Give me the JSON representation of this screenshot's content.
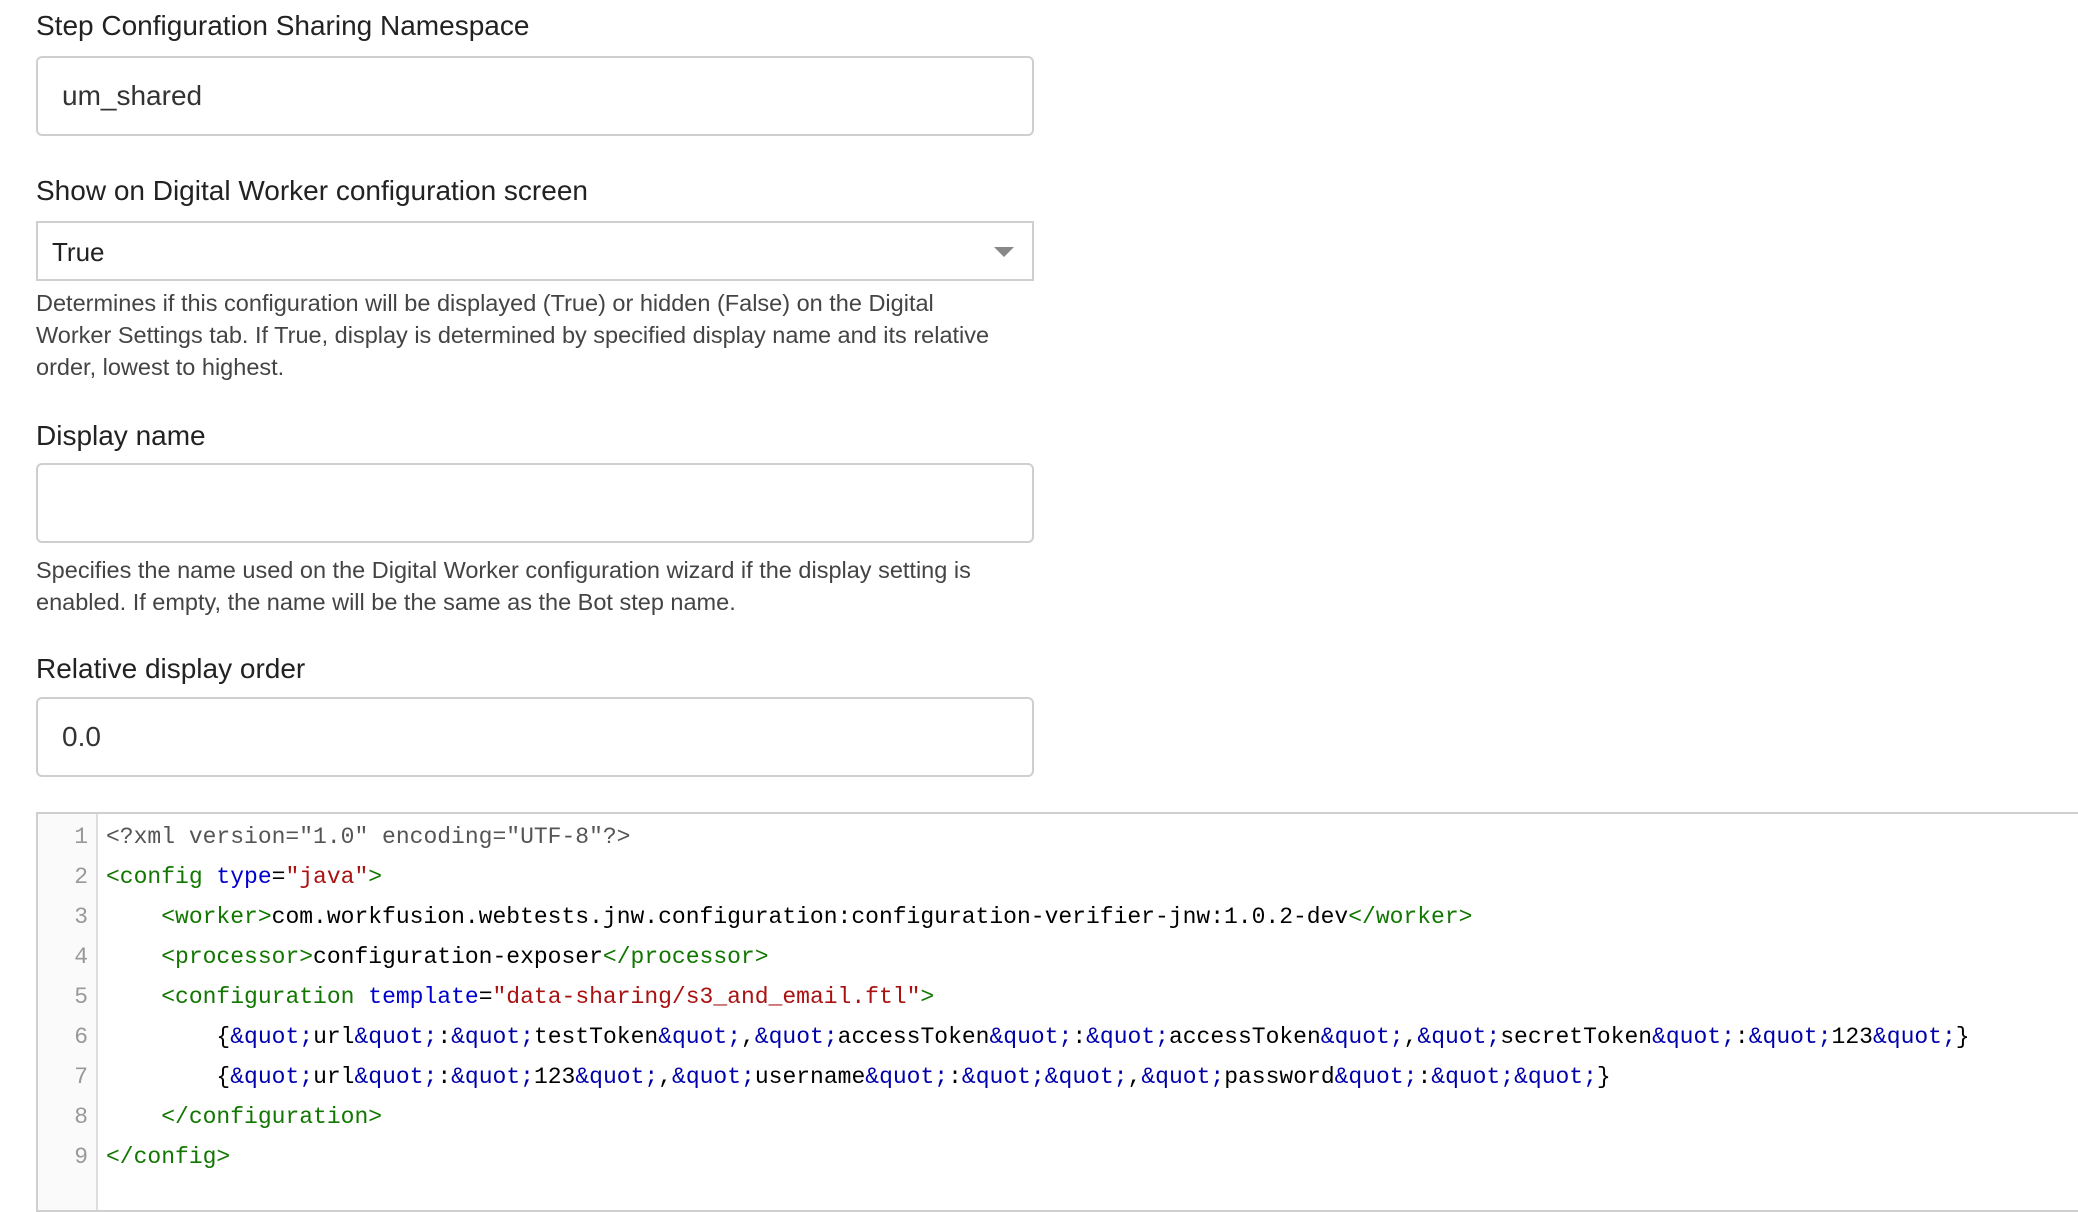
{
  "fields": {
    "namespace": {
      "label": "Step Configuration Sharing Namespace",
      "value": "um_shared"
    },
    "show_on_screen": {
      "label": "Show on Digital Worker configuration screen",
      "selected": "True",
      "help_line1": "Determines if this configuration will be displayed (True) or hidden (False) on the Digital",
      "help_line2": "Worker Settings tab. If True, display is determined by specified display name and its relative",
      "help_line3": "order, lowest to highest."
    },
    "display_name": {
      "label": "Display name",
      "value": "",
      "help_line1": "Specifies the name used on the Digital Worker configuration wizard if the display setting is",
      "help_line2": "enabled. If empty, the name will be the same as the Bot step name."
    },
    "display_order": {
      "label": "Relative display order",
      "value": "0.0"
    }
  },
  "code_editor": {
    "lines": [
      {
        "no": "1",
        "tokens": [
          {
            "c": "meta",
            "t": "<?xml version=\"1.0\" encoding=\"UTF-8\"?>"
          }
        ]
      },
      {
        "no": "2",
        "tokens": [
          {
            "c": "tag",
            "t": "<config "
          },
          {
            "c": "attr",
            "t": "type"
          },
          {
            "c": "txt",
            "t": "="
          },
          {
            "c": "str",
            "t": "\"java\""
          },
          {
            "c": "tag",
            "t": ">"
          }
        ]
      },
      {
        "no": "3",
        "tokens": [
          {
            "c": "txt",
            "t": "    "
          },
          {
            "c": "tag",
            "t": "<worker>"
          },
          {
            "c": "txt",
            "t": "com.workfusion.webtests.jnw.configuration:configuration-verifier-jnw:1.0.2-dev"
          },
          {
            "c": "tag",
            "t": "</worker>"
          }
        ]
      },
      {
        "no": "4",
        "tokens": [
          {
            "c": "txt",
            "t": "    "
          },
          {
            "c": "tag",
            "t": "<processor>"
          },
          {
            "c": "txt",
            "t": "configuration-exposer"
          },
          {
            "c": "tag",
            "t": "</processor>"
          }
        ]
      },
      {
        "no": "5",
        "tokens": [
          {
            "c": "txt",
            "t": "    "
          },
          {
            "c": "tag",
            "t": "<configuration "
          },
          {
            "c": "attr",
            "t": "template"
          },
          {
            "c": "txt",
            "t": "="
          },
          {
            "c": "str",
            "t": "\"data-sharing/s3_and_email.ftl\""
          },
          {
            "c": "tag",
            "t": ">"
          }
        ]
      },
      {
        "no": "6",
        "tokens": [
          {
            "c": "txt",
            "t": "        {"
          },
          {
            "c": "ent",
            "t": "&quot;"
          },
          {
            "c": "txt",
            "t": "url"
          },
          {
            "c": "ent",
            "t": "&quot;"
          },
          {
            "c": "txt",
            "t": ":"
          },
          {
            "c": "ent",
            "t": "&quot;"
          },
          {
            "c": "txt",
            "t": "testToken"
          },
          {
            "c": "ent",
            "t": "&quot;"
          },
          {
            "c": "txt",
            "t": ","
          },
          {
            "c": "ent",
            "t": "&quot;"
          },
          {
            "c": "txt",
            "t": "accessToken"
          },
          {
            "c": "ent",
            "t": "&quot;"
          },
          {
            "c": "txt",
            "t": ":"
          },
          {
            "c": "ent",
            "t": "&quot;"
          },
          {
            "c": "txt",
            "t": "accessToken"
          },
          {
            "c": "ent",
            "t": "&quot;"
          },
          {
            "c": "txt",
            "t": ","
          },
          {
            "c": "ent",
            "t": "&quot;"
          },
          {
            "c": "txt",
            "t": "secretToken"
          },
          {
            "c": "ent",
            "t": "&quot;"
          },
          {
            "c": "txt",
            "t": ":"
          },
          {
            "c": "ent",
            "t": "&quot;"
          },
          {
            "c": "txt",
            "t": "123"
          },
          {
            "c": "ent",
            "t": "&quot;"
          },
          {
            "c": "txt",
            "t": "}"
          }
        ]
      },
      {
        "no": "7",
        "tokens": [
          {
            "c": "txt",
            "t": "        {"
          },
          {
            "c": "ent",
            "t": "&quot;"
          },
          {
            "c": "txt",
            "t": "url"
          },
          {
            "c": "ent",
            "t": "&quot;"
          },
          {
            "c": "txt",
            "t": ":"
          },
          {
            "c": "ent",
            "t": "&quot;"
          },
          {
            "c": "txt",
            "t": "123"
          },
          {
            "c": "ent",
            "t": "&quot;"
          },
          {
            "c": "txt",
            "t": ","
          },
          {
            "c": "ent",
            "t": "&quot;"
          },
          {
            "c": "txt",
            "t": "username"
          },
          {
            "c": "ent",
            "t": "&quot;"
          },
          {
            "c": "txt",
            "t": ":"
          },
          {
            "c": "ent",
            "t": "&quot;"
          },
          {
            "c": "ent",
            "t": "&quot;"
          },
          {
            "c": "txt",
            "t": ","
          },
          {
            "c": "ent",
            "t": "&quot;"
          },
          {
            "c": "txt",
            "t": "password"
          },
          {
            "c": "ent",
            "t": "&quot;"
          },
          {
            "c": "txt",
            "t": ":"
          },
          {
            "c": "ent",
            "t": "&quot;"
          },
          {
            "c": "ent",
            "t": "&quot;"
          },
          {
            "c": "txt",
            "t": "}"
          }
        ]
      },
      {
        "no": "8",
        "tokens": [
          {
            "c": "txt",
            "t": "    "
          },
          {
            "c": "tag",
            "t": "</configuration>"
          }
        ]
      },
      {
        "no": "9",
        "tokens": [
          {
            "c": "tag",
            "t": "</config>"
          }
        ]
      }
    ]
  }
}
